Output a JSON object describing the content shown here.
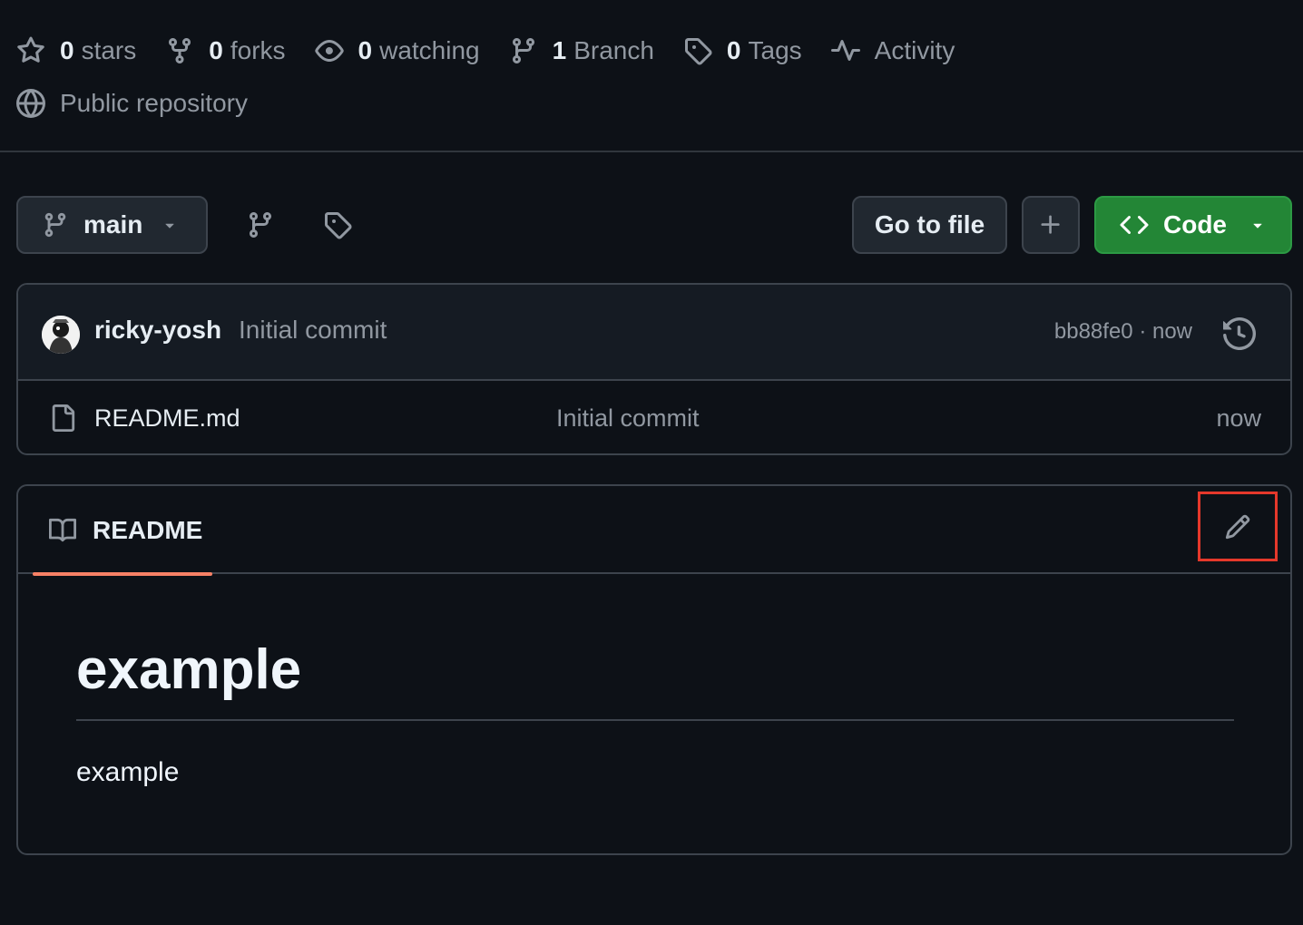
{
  "stats": {
    "stars": {
      "num": "0",
      "label": "stars",
      "icon": "star-icon"
    },
    "forks": {
      "num": "0",
      "label": "forks",
      "icon": "fork-icon"
    },
    "watching": {
      "num": "0",
      "label": "watching",
      "icon": "eye-icon"
    },
    "branches": {
      "num": "1",
      "label": "Branch",
      "icon": "branch-icon"
    },
    "tags": {
      "num": "0",
      "label": "Tags",
      "icon": "tag-icon"
    },
    "activity": {
      "label": "Activity",
      "icon": "pulse-icon"
    }
  },
  "visibility": {
    "label": "Public repository",
    "icon": "globe-icon"
  },
  "toolbar": {
    "branch_label": "main",
    "goto_label": "Go to file",
    "code_label": "Code"
  },
  "latest_commit": {
    "author": "ricky-yosh",
    "message": "Initial commit",
    "meta": "bb88fe0 · now"
  },
  "files": [
    {
      "name": "README.md",
      "commit_message": "Initial commit",
      "time": "now"
    }
  ],
  "readme": {
    "tab_label": "README",
    "heading": "example",
    "paragraph": "example"
  },
  "colors": {
    "background": "#0d1117",
    "code_button": "#238636",
    "tab_underline": "#f78166",
    "highlight_box": "#e5382b"
  }
}
